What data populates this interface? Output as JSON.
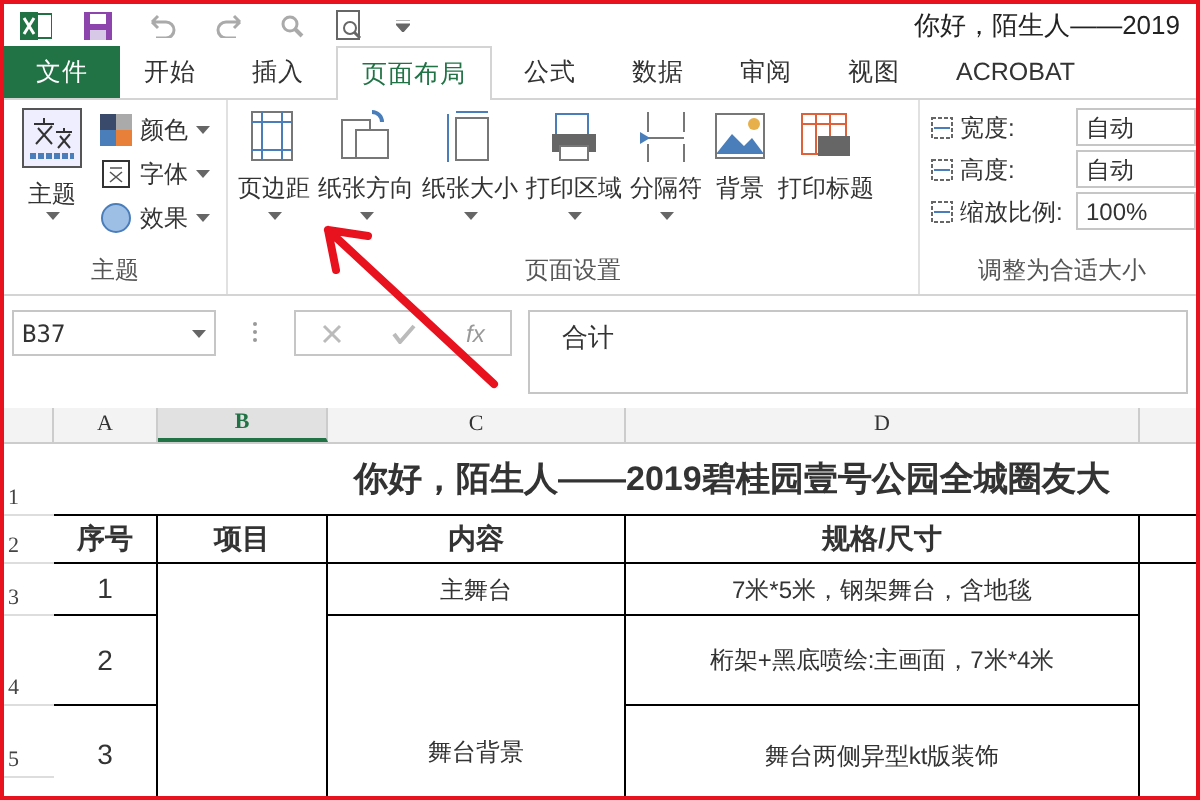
{
  "window": {
    "title": "你好，陌生人——2019"
  },
  "tabs": [
    {
      "label": "文件",
      "kind": "file",
      "selected": false
    },
    {
      "label": "开始",
      "kind": "tab",
      "selected": false
    },
    {
      "label": "插入",
      "kind": "tab",
      "selected": false
    },
    {
      "label": "页面布局",
      "kind": "tab",
      "selected": true
    },
    {
      "label": "公式",
      "kind": "tab",
      "selected": false
    },
    {
      "label": "数据",
      "kind": "tab",
      "selected": false
    },
    {
      "label": "审阅",
      "kind": "tab",
      "selected": false
    },
    {
      "label": "视图",
      "kind": "tab",
      "selected": false
    },
    {
      "label": "ACROBAT",
      "kind": "tab",
      "selected": false
    }
  ],
  "ribbon": {
    "theme_group": {
      "label": "主题",
      "big": "主题",
      "small": [
        "颜色",
        "字体",
        "效果"
      ]
    },
    "page_setup_group": {
      "label": "页面设置",
      "buttons": [
        {
          "label": "页边距",
          "kind": "margins",
          "dropdown": true
        },
        {
          "label": "纸张方向",
          "kind": "orientation",
          "dropdown": true
        },
        {
          "label": "纸张大小",
          "kind": "size",
          "dropdown": true
        },
        {
          "label": "打印区域",
          "kind": "area",
          "dropdown": true
        },
        {
          "label": "分隔符",
          "kind": "breaks",
          "dropdown": true
        },
        {
          "label": "背景",
          "kind": "background",
          "dropdown": false
        },
        {
          "label": "打印标题",
          "kind": "titles",
          "dropdown": false
        }
      ]
    },
    "scale_group": {
      "label": "调整为合适大小",
      "fields": [
        {
          "label": "宽度:",
          "value": "自动"
        },
        {
          "label": "高度:",
          "value": "自动"
        },
        {
          "label": "缩放比例:",
          "value": "100%"
        }
      ]
    }
  },
  "formula_bar": {
    "name_box": "B37",
    "fx": "fx",
    "content": "合计"
  },
  "sheet": {
    "columns": [
      {
        "label": "A",
        "selected": false
      },
      {
        "label": "B",
        "selected": true
      },
      {
        "label": "C",
        "selected": false
      },
      {
        "label": "D",
        "selected": false
      }
    ],
    "row_numbers": [
      "1",
      "2",
      "3",
      "4",
      "5"
    ],
    "title": "你好，陌生人——2019碧桂园壹号公园全城圈友大",
    "headers": [
      "序号",
      "项目",
      "内容",
      "规格/尺寸"
    ],
    "rows": [
      {
        "no": "1",
        "content": "主舞台",
        "spec": "7米*5米，钢架舞台，含地毯"
      },
      {
        "no": "2",
        "spec": "桁架+黑底喷绘:主画面，7米*4米"
      },
      {
        "no": "3",
        "content": "舞台背景",
        "spec": "舞台两侧异型kt版装饰"
      }
    ]
  }
}
